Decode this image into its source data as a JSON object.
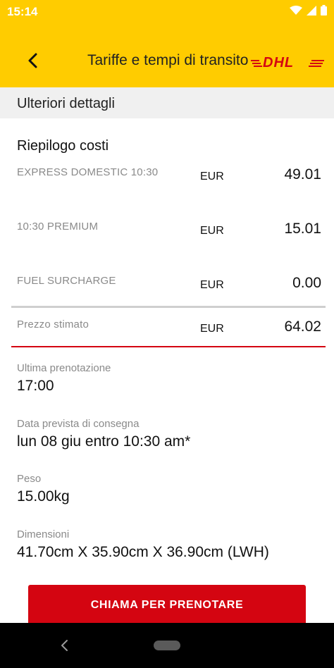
{
  "status": {
    "time": "15:14"
  },
  "header": {
    "title": "Tariffe e tempi di transito",
    "back_icon": "arrow-back-icon",
    "logo": "DHL",
    "bg_color": "#FFCC00"
  },
  "section": {
    "title": "Ulteriori dettagli"
  },
  "summary": {
    "title": "Riepilogo costi",
    "rows": [
      {
        "label": "EXPRESS DOMESTIC 10:30",
        "currency": "EUR",
        "value": "49.01"
      },
      {
        "label": "10:30 PREMIUM",
        "currency": "EUR",
        "value": "15.01"
      },
      {
        "label": "FUEL SURCHARGE",
        "currency": "EUR",
        "value": "0.00"
      }
    ],
    "total": {
      "label": "Prezzo stimato",
      "currency": "EUR",
      "value": "64.02"
    }
  },
  "details": {
    "last_booking": {
      "label": "Ultima prenotazione",
      "value": "17:00"
    },
    "delivery": {
      "label": "Data prevista di consegna",
      "value": "lun 08 giu entro 10:30 am*"
    },
    "weight": {
      "label": "Peso",
      "value": "15.00kg"
    },
    "dimensions": {
      "label": "Dimensioni",
      "value": "41.70cm X 35.90cm X 36.90cm (LWH)"
    }
  },
  "cta": {
    "label": "CHIAMA PER PRENOTARE",
    "color": "#D40511"
  }
}
